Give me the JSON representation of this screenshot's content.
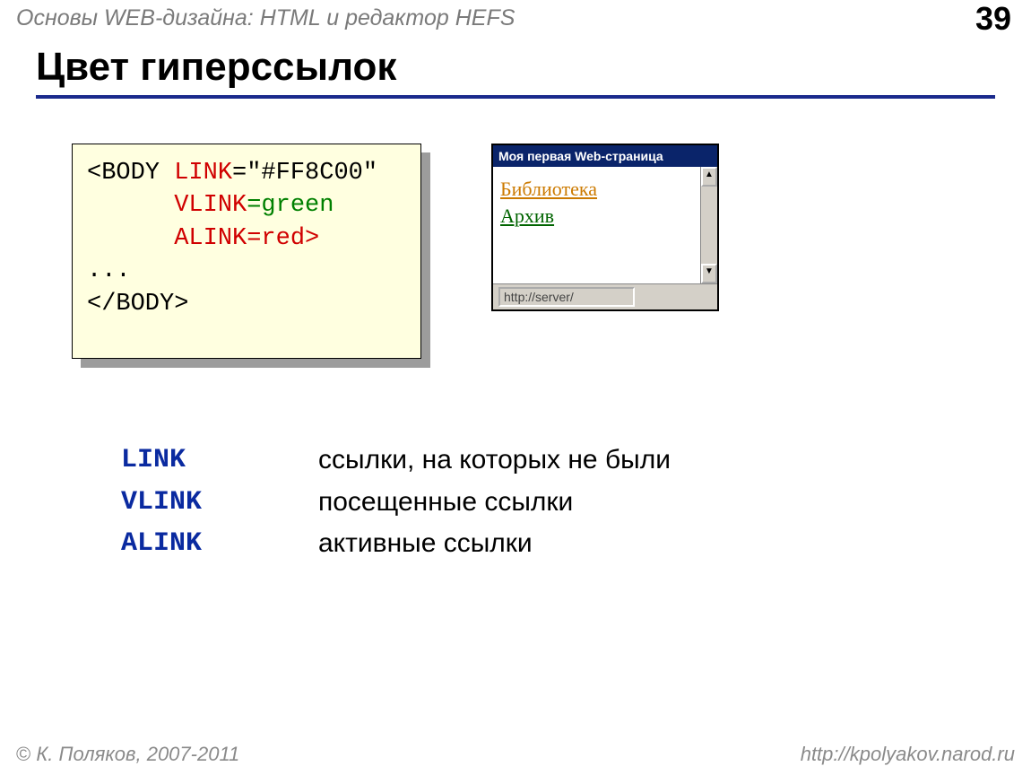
{
  "header": {
    "course": "Основы WEB-дизайна: HTML и редактор HEFS",
    "page": "39"
  },
  "title": "Цвет гиперссылок",
  "code": {
    "line1a": "<BODY ",
    "line1b": "LINK",
    "line1c": "=\"#FF8C00\"",
    "line2a": "      ",
    "line2b": "VLINK",
    "line2c": "=green",
    "line3a": "      ",
    "line3b": "ALINK",
    "line3c": "=red>",
    "line4": "...",
    "line5": "</BODY>"
  },
  "browser": {
    "title": "Моя первая Web-страница",
    "link1": "Библиотека",
    "link2": "Архив",
    "status": "http://server/"
  },
  "defs": [
    {
      "term": "LINK",
      "desc": "ссылки, на которых не были"
    },
    {
      "term": "VLINK",
      "desc": "посещенные ссылки"
    },
    {
      "term": "ALINK",
      "desc": "активные ссылки"
    }
  ],
  "footer": {
    "left": "К. Поляков, 2007-2011",
    "right": "http://kpolyakov.narod.ru"
  }
}
